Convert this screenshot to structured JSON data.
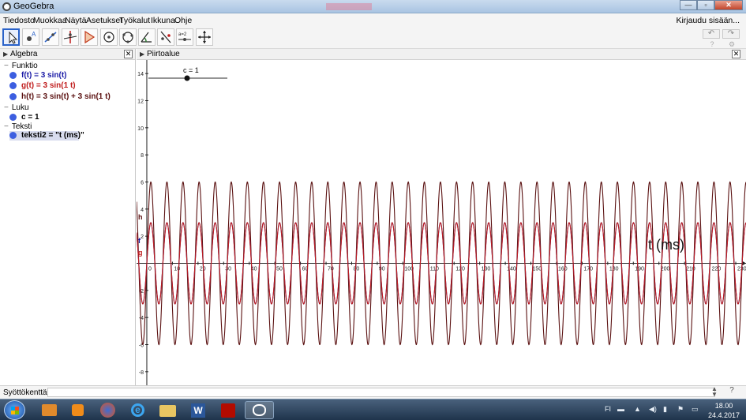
{
  "window": {
    "title": "GeoGebra"
  },
  "menu": {
    "items": [
      "Tiedosto",
      "Muokkaa",
      "Näytä",
      "Asetukset",
      "Työkalut",
      "Ikkuna",
      "Ohje"
    ],
    "login": "Kirjaudu sisään..."
  },
  "toolbar": {
    "tools": [
      "move-tool",
      "point-tool",
      "line-tool",
      "perpendicular-tool",
      "polygon-tool",
      "circle-tool",
      "circle-three-points-tool",
      "angle-tool",
      "reflect-tool",
      "slider-tool",
      "move-graphics-tool"
    ],
    "slider_tool_label": "a=2"
  },
  "algebra": {
    "title": "Algebra",
    "groups": [
      {
        "name": "Funktio",
        "items": [
          {
            "text": "f(t) = 3 sin(t)",
            "color": "#1a1aa6"
          },
          {
            "text": "g(t) = 3 sin(1 t)",
            "color": "#c01c1c"
          },
          {
            "text": "h(t) = 3 sin(t) + 3 sin(1 t)",
            "color": "#5a1010"
          }
        ]
      },
      {
        "name": "Luku",
        "items": [
          {
            "text": "c = 1",
            "color": "#000000"
          }
        ]
      },
      {
        "name": "Teksti",
        "items": [
          {
            "text": "teksti2 = \"t (ms)\"",
            "color": "#000000"
          }
        ]
      }
    ]
  },
  "graphics": {
    "title": "Piirtoalue",
    "slider": {
      "label": "c = 1",
      "value": 1
    },
    "axis_text": "t (ms)",
    "curve_labels": {
      "h": "h",
      "f": "f",
      "g": "g"
    }
  },
  "inputbar": {
    "label": "Syöttökenttä:",
    "value": ""
  },
  "taskbar": {
    "apps": [
      "start-button",
      "explorer-app",
      "media-player-app",
      "firefox-app",
      "internet-explorer-app",
      "file-manager-app",
      "word-app",
      "acrobat-app",
      "geogebra-app"
    ],
    "language": "FI",
    "time": "18.00",
    "date": "24.4.2017"
  },
  "chart_data": {
    "type": "line",
    "xlim": [
      -4,
      234
    ],
    "ylim": [
      -9,
      15
    ],
    "x_ticks": [
      0,
      10,
      20,
      30,
      40,
      50,
      60,
      70,
      80,
      90,
      100,
      110,
      120,
      130,
      140,
      150,
      160,
      170,
      180,
      190,
      200,
      210,
      220,
      230
    ],
    "y_ticks": [
      -8,
      -6,
      -4,
      -2,
      2,
      4,
      6,
      8,
      10,
      12,
      14
    ],
    "grid": false,
    "series": [
      {
        "name": "f",
        "expression": "3 sin(t)",
        "amplitude": 3,
        "color": "#1a1aa6"
      },
      {
        "name": "g",
        "expression": "3 sin(1 t)",
        "amplitude": 3,
        "color": "#c01c1c"
      },
      {
        "name": "h",
        "expression": "3 sin(t) + 3 sin(1 t)",
        "amplitude": 6,
        "color": "#5a1010"
      }
    ]
  },
  "colors": {
    "accent": "#2a62c9",
    "dot": "#3c5ee0"
  }
}
